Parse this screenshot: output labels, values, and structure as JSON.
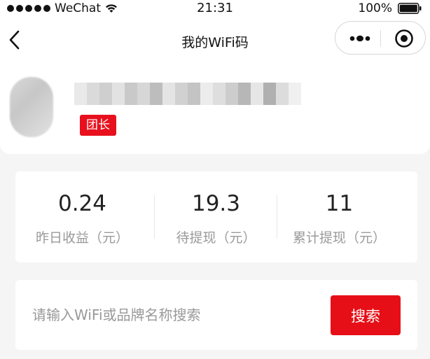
{
  "status_bar": {
    "carrier": "WeChat",
    "time": "21:31",
    "battery": "100%"
  },
  "nav": {
    "title": "我的WiFi码"
  },
  "profile": {
    "role_badge": "团长"
  },
  "stats": [
    {
      "value": "0.24",
      "label": "昨日收益（元）"
    },
    {
      "value": "19.3",
      "label": "待提现（元）"
    },
    {
      "value": "11",
      "label": "累计提现（元）"
    }
  ],
  "search": {
    "placeholder": "请输入WiFi或品牌名称搜索",
    "button_label": "搜索"
  },
  "colors": {
    "accent": "#e60f17",
    "background": "#f5f5f5"
  }
}
